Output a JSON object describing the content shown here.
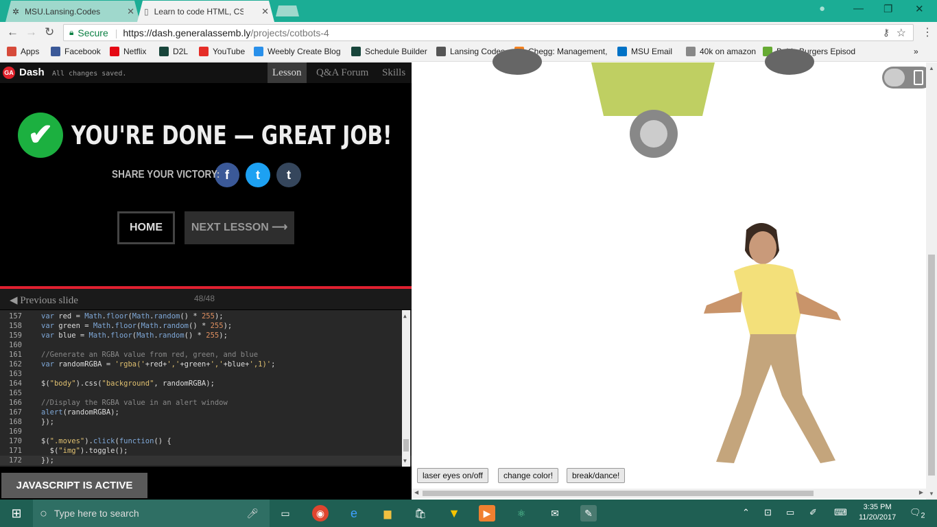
{
  "browser": {
    "tabs": [
      {
        "label": "MSU.Lansing.Codes"
      },
      {
        "label": "Learn to code HTML, CSS"
      }
    ],
    "secure_label": "Secure",
    "url_host": "https://dash.generalassemb.ly",
    "url_path": "/projects/cotbots-4",
    "bookmarks": [
      {
        "label": "Apps",
        "icon": "apps-grid-icon",
        "color": "#d64a3a"
      },
      {
        "label": "Facebook",
        "icon": "facebook-icon",
        "color": "#3b5998"
      },
      {
        "label": "Netflix",
        "icon": "netflix-icon",
        "color": "#e50914"
      },
      {
        "label": "D2L",
        "icon": "d2l-icon",
        "color": "#18453b"
      },
      {
        "label": "YouTube",
        "icon": "youtube-icon",
        "color": "#e52d27"
      },
      {
        "label": "Weebly Create Blog",
        "icon": "weebly-icon",
        "color": "#2990ea"
      },
      {
        "label": "Schedule Builder",
        "icon": "spartan-icon",
        "color": "#18453b"
      },
      {
        "label": "Lansing Codes",
        "icon": "lansing-codes-icon",
        "color": "#555555"
      },
      {
        "label": "Chegg: Management,",
        "icon": "chegg-icon",
        "color": "#f58220"
      },
      {
        "label": "MSU Email",
        "icon": "outlook-icon",
        "color": "#0072c6"
      },
      {
        "label": "40k on amazon",
        "icon": "page-icon",
        "color": "#888888"
      },
      {
        "label": "Bob's Burgers Episod",
        "icon": "hulu-icon",
        "color": "#66aa33"
      }
    ]
  },
  "dash": {
    "logo": "GA",
    "name": "Dash",
    "status": "All changes saved.",
    "tabs": [
      {
        "label": "Lesson"
      },
      {
        "label": "Q&A Forum"
      },
      {
        "label": "Skills"
      }
    ],
    "done_title": "YOU'RE DONE — GREAT JOB!",
    "share_label": "SHARE YOUR VICTORY:",
    "share_icons": [
      {
        "glyph": "f",
        "icon": "facebook-icon",
        "color": "#3b5998"
      },
      {
        "glyph": "t",
        "icon": "twitter-icon",
        "color": "#1da1f2"
      },
      {
        "glyph": "t",
        "icon": "tumblr-icon",
        "color": "#35465c"
      }
    ],
    "home_label": "HOME",
    "next_label": "NEXT LESSON ⟶",
    "prev_label": "Previous slide",
    "slide_count": "48/48",
    "js_status": "JAVASCRIPT IS ACTIVE"
  },
  "code_lines": [
    {
      "n": "157",
      "html": "<span class=\"kw\">var</span> red = <span class=\"fn\">Math</span>.<span class=\"fn\">floor</span>(<span class=\"fn\">Math</span>.<span class=\"fn\">random</span>() * <span class=\"num\">255</span>);"
    },
    {
      "n": "158",
      "html": "<span class=\"kw\">var</span> green = <span class=\"fn\">Math</span>.<span class=\"fn\">floor</span>(<span class=\"fn\">Math</span>.<span class=\"fn\">random</span>() * <span class=\"num\">255</span>);"
    },
    {
      "n": "159",
      "html": "<span class=\"kw\">var</span> blue = <span class=\"fn\">Math</span>.<span class=\"fn\">floor</span>(<span class=\"fn\">Math</span>.<span class=\"fn\">random</span>() * <span class=\"num\">255</span>);"
    },
    {
      "n": "160",
      "html": ""
    },
    {
      "n": "161",
      "html": "<span class=\"cm\">//Generate an RGBA value from red, green, and blue</span>"
    },
    {
      "n": "162",
      "html": "<span class=\"kw\">var</span> randomRGBA = <span class=\"str\">'rgba('</span>+red+<span class=\"str\">','</span>+green+<span class=\"str\">','</span>+blue+<span class=\"str\">',1)'</span>;"
    },
    {
      "n": "163",
      "html": ""
    },
    {
      "n": "164",
      "html": "$(<span class=\"str\">\"body\"</span>).css(<span class=\"str\">\"background\"</span>, randomRGBA);"
    },
    {
      "n": "165",
      "html": ""
    },
    {
      "n": "166",
      "html": "<span class=\"cm\">//Display the RGBA value in an alert window</span>"
    },
    {
      "n": "167",
      "html": "<span class=\"fn\">alert</span>(randomRGBA);"
    },
    {
      "n": "168",
      "html": "});"
    },
    {
      "n": "169",
      "html": ""
    },
    {
      "n": "170",
      "html": "$(<span class=\"str\">\".moves\"</span>).<span class=\"fn\">click</span>(<span class=\"kw\">function</span>() {"
    },
    {
      "n": "171",
      "html": "  $(<span class=\"str\">\"img\"</span>).toggle();"
    },
    {
      "n": "172",
      "html": "});"
    }
  ],
  "preview": {
    "buttons": [
      {
        "label": "laser eyes on/off"
      },
      {
        "label": "change color!"
      },
      {
        "label": "break/dance!"
      }
    ],
    "bot_color": "#bfcf62"
  },
  "taskbar": {
    "search_placeholder": "Type here to search",
    "time": "3:35 PM",
    "date": "11/20/2017",
    "notifications": "2"
  }
}
